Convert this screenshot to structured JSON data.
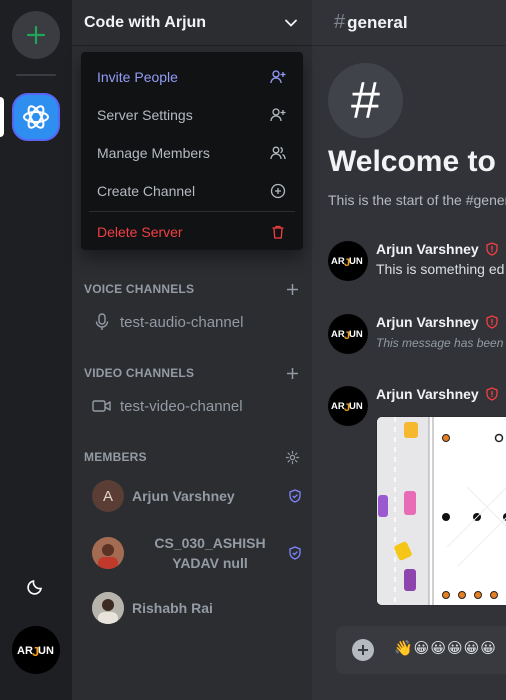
{
  "server": {
    "name": "Code with Arjun"
  },
  "menu": {
    "items": [
      {
        "label": "Invite People",
        "icon": "person-add-icon"
      },
      {
        "label": "Server Settings",
        "icon": "person-add-icon"
      },
      {
        "label": "Manage Members",
        "icon": "users-icon"
      },
      {
        "label": "Create Channel",
        "icon": "plus-circle-icon"
      }
    ],
    "danger": {
      "label": "Delete Server",
      "icon": "trash-icon"
    }
  },
  "sections": {
    "voice": {
      "title": "VOICE CHANNELS",
      "channels": [
        "test-audio-channel"
      ]
    },
    "video": {
      "title": "VIDEO CHANNELS",
      "channels": [
        "test-video-channel"
      ]
    },
    "members": {
      "title": "MEMBERS"
    }
  },
  "members": [
    {
      "name": "Arjun Varshney",
      "initial": "A",
      "role_icon": "shield-check-icon"
    },
    {
      "name": "CS_030_ASHISH YADAV null",
      "line1": "CS_030_ASHISH",
      "line2": "YADAV null",
      "role_icon": "shield-check-icon"
    },
    {
      "name": "Rishabh Rai"
    }
  ],
  "channel": {
    "hash": "#",
    "name": "general",
    "welcome": "Welcome to",
    "subtitle": "This is the start of the #general"
  },
  "messages": [
    {
      "author": "Arjun Varshney",
      "text": "This is something ed"
    },
    {
      "author": "Arjun Varshney",
      "text": "This message has been"
    },
    {
      "author": "Arjun Varshney",
      "text": ""
    }
  ],
  "logo_text": "ARJUN",
  "composer": {
    "emojis": "👋😀😀😀😀😀"
  },
  "colors": {
    "accent": "#5865f2",
    "online": "#23a559",
    "danger": "#f23f42",
    "invite": "#949cf7"
  }
}
